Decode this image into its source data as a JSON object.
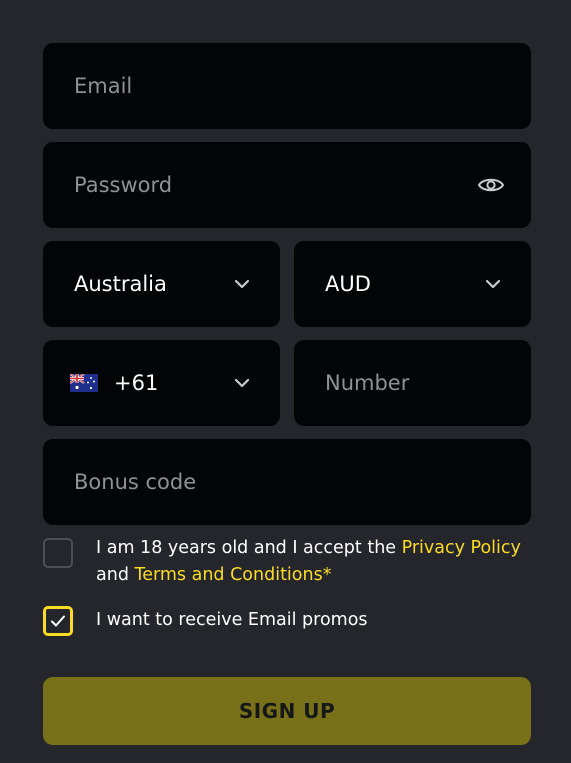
{
  "email": {
    "placeholder": "Email"
  },
  "password": {
    "placeholder": "Password"
  },
  "country": {
    "selected": "Australia"
  },
  "currency": {
    "selected": "AUD"
  },
  "phone_code": {
    "selected": "+61"
  },
  "phone_number": {
    "placeholder": "Number"
  },
  "bonus_code": {
    "placeholder": "Bonus code"
  },
  "age_consent": {
    "checked": false,
    "text_before": "I am 18 years old and I accept the ",
    "privacy_link": "Privacy Policy",
    "text_middle": " and ",
    "terms_link": "Terms and Conditions*"
  },
  "email_promos": {
    "checked": true,
    "label": "I want to receive Email promos"
  },
  "signup_button": {
    "label": "SIGN UP"
  },
  "icons": {
    "password_toggle": "eye-icon",
    "dropdown": "chevron-down-icon",
    "country_flag": "australia-flag-icon",
    "checkmark": "checkmark-icon"
  },
  "colors": {
    "background": "#25262b",
    "field": "#030405",
    "accent": "#fbdb24",
    "button": "#78711a"
  }
}
